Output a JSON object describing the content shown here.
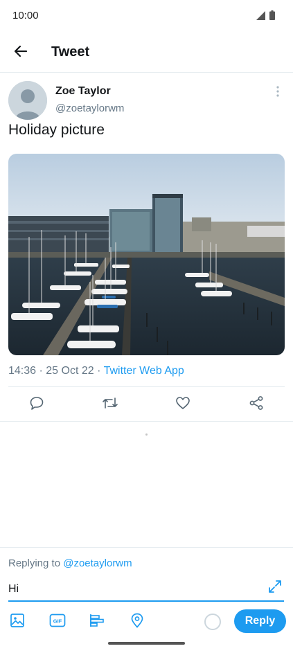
{
  "status_bar": {
    "time": "10:00",
    "icons": [
      "signal-icon",
      "battery-icon"
    ]
  },
  "header": {
    "title": "Tweet",
    "back_icon": "arrow-left-icon"
  },
  "tweet": {
    "author_name": "Zoe Taylor",
    "author_handle": "@zoetaylorwm",
    "text": "Holiday picture",
    "time": "14:36",
    "date": "25 Oct 22",
    "separator": "·",
    "source": "Twitter Web App",
    "image_subject": "harbor-marina-photo"
  },
  "actions": [
    "reply-icon",
    "retweet-icon",
    "like-icon",
    "share-icon"
  ],
  "compose": {
    "replying_prefix": "Replying to",
    "replying_handle": "@zoetaylorwm",
    "input_value": "Hi",
    "reply_label": "Reply",
    "tools": [
      "image-icon",
      "gif-icon",
      "poll-icon",
      "location-icon"
    ]
  },
  "colors": {
    "accent": "#1d9bf0",
    "secondary_text": "#657786",
    "divider": "#e6ecf0"
  }
}
